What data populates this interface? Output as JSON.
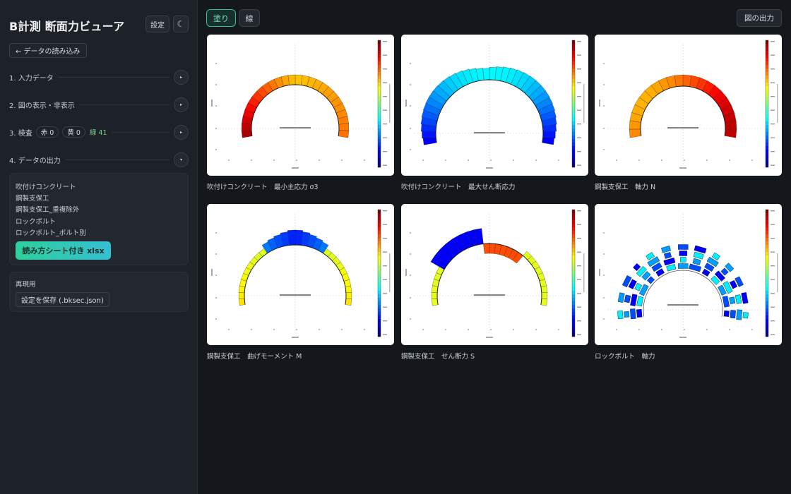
{
  "app": {
    "title": "B計測 断面力ビューア"
  },
  "header": {
    "settings_label": "設定",
    "theme_icon": "moon-icon",
    "theme_glyph": "☾"
  },
  "sidebar": {
    "load_button": "← データの読み込み",
    "sections": [
      {
        "label": "1. 入力データ",
        "toggle_glyph": "▸"
      },
      {
        "label": "2. 図の表示・非表示",
        "toggle_glyph": "▸"
      },
      {
        "label": "3. 検査",
        "toggle_glyph": "▸"
      },
      {
        "label": "4. データの出力",
        "toggle_glyph": "▾"
      }
    ],
    "check": {
      "red": "赤 0",
      "yellow": "黄 0",
      "green": "緑 41"
    },
    "export_items": [
      "吹付けコンクリート",
      "鋼製支保工",
      "鋼製支保工_重複除外",
      "ロックボルト",
      "ロックボルト_ボルト別"
    ],
    "xlsx_button": "読み方シート付き xlsx",
    "reuse": {
      "label": "再現用",
      "save_button": "設定を保存 (.bksec.json)"
    }
  },
  "toolbar": {
    "mode_tabs": [
      {
        "label": "塗り",
        "active": true
      },
      {
        "label": "線",
        "active": false
      }
    ],
    "export_figure": "図の出力"
  },
  "figures": [
    {
      "caption": "吹付けコンクリート　最小主応力 σ3",
      "colormap": "jet",
      "color_theme": "red"
    },
    {
      "caption": "吹付けコンクリート　最大せん断応力",
      "colormap": "jet",
      "color_theme": "blue"
    },
    {
      "caption": "鋼製支保工　軸力 N",
      "colormap": "jet",
      "color_theme": "red"
    },
    {
      "caption": "鋼製支保工　曲げモーメント M",
      "colormap": "jet",
      "color_theme": "mixed"
    },
    {
      "caption": "鋼製支保工　せん断力 S",
      "colormap": "jet",
      "color_theme": "mixed"
    },
    {
      "caption": "ロックボルト　軸力",
      "colormap": "jet",
      "color_theme": "blue"
    }
  ],
  "colors": {
    "accent": "#2fcf9c",
    "accent_alt": "#34bfd2",
    "background": "#14171c",
    "sidebar": "#1d2128",
    "ok_green": "#7fd18a"
  }
}
